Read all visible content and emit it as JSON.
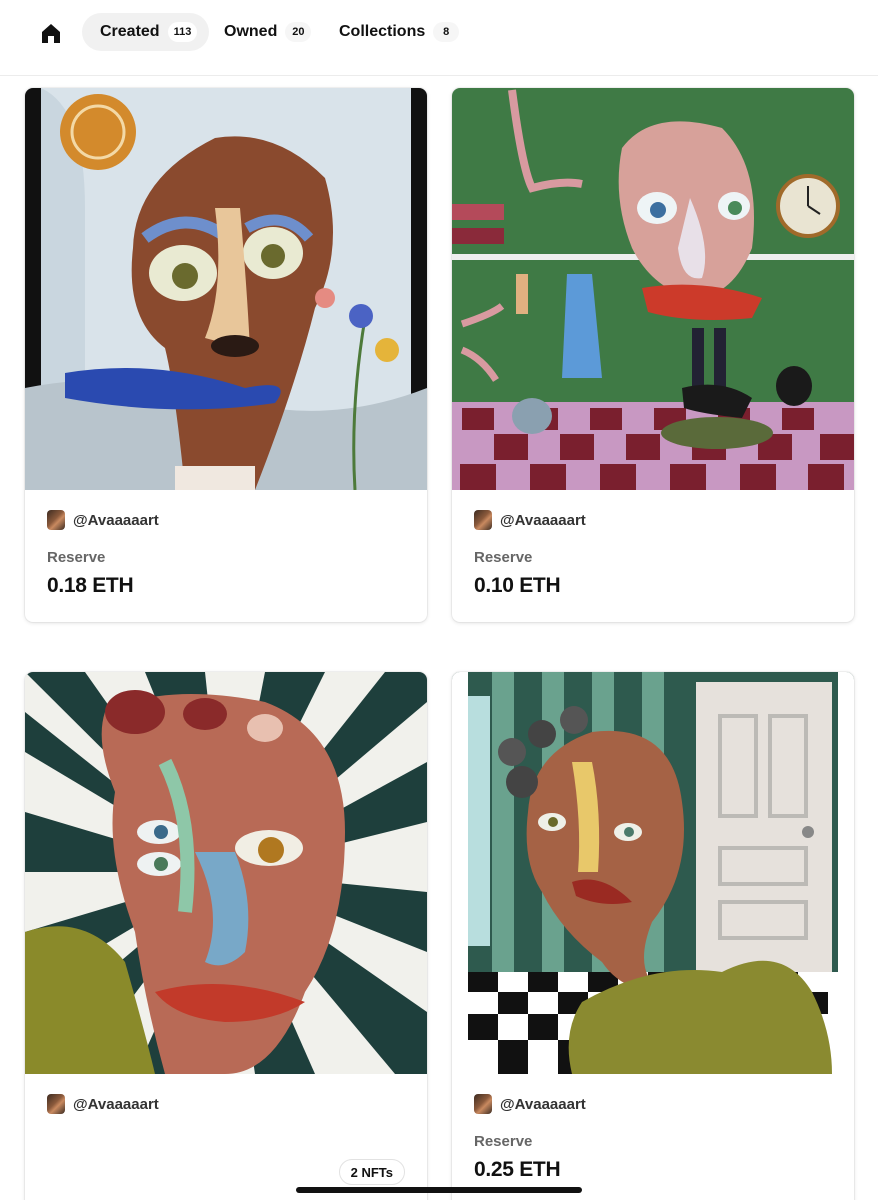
{
  "tabs": [
    {
      "label": "Created",
      "count": "113",
      "active": true
    },
    {
      "label": "Owned",
      "count": "20",
      "active": false
    },
    {
      "label": "Collections",
      "count": "8",
      "active": false
    }
  ],
  "cards": [
    {
      "creator": "@Avaaaaart",
      "price_label": "Reserve",
      "price": "0.18 ETH",
      "artwork": "face-with-flies-and-flowers"
    },
    {
      "creator": "@Avaaaaart",
      "price_label": "Reserve",
      "price": "0.10 ETH",
      "artwork": "face-in-green-room-with-clock"
    },
    {
      "creator": "@Avaaaaart",
      "badge": "2 NFTs",
      "artwork": "face-with-sunburst-rays"
    },
    {
      "creator": "@Avaaaaart",
      "price_label": "Reserve",
      "price": "0.25 ETH",
      "artwork": "face-by-door-on-checkered-floor"
    }
  ],
  "icons": {
    "home": "home-icon",
    "avatar": "creator-avatar"
  },
  "colors": {
    "active_tab_bg": "#f1f1f1",
    "text": "#111111",
    "muted": "#666666"
  }
}
